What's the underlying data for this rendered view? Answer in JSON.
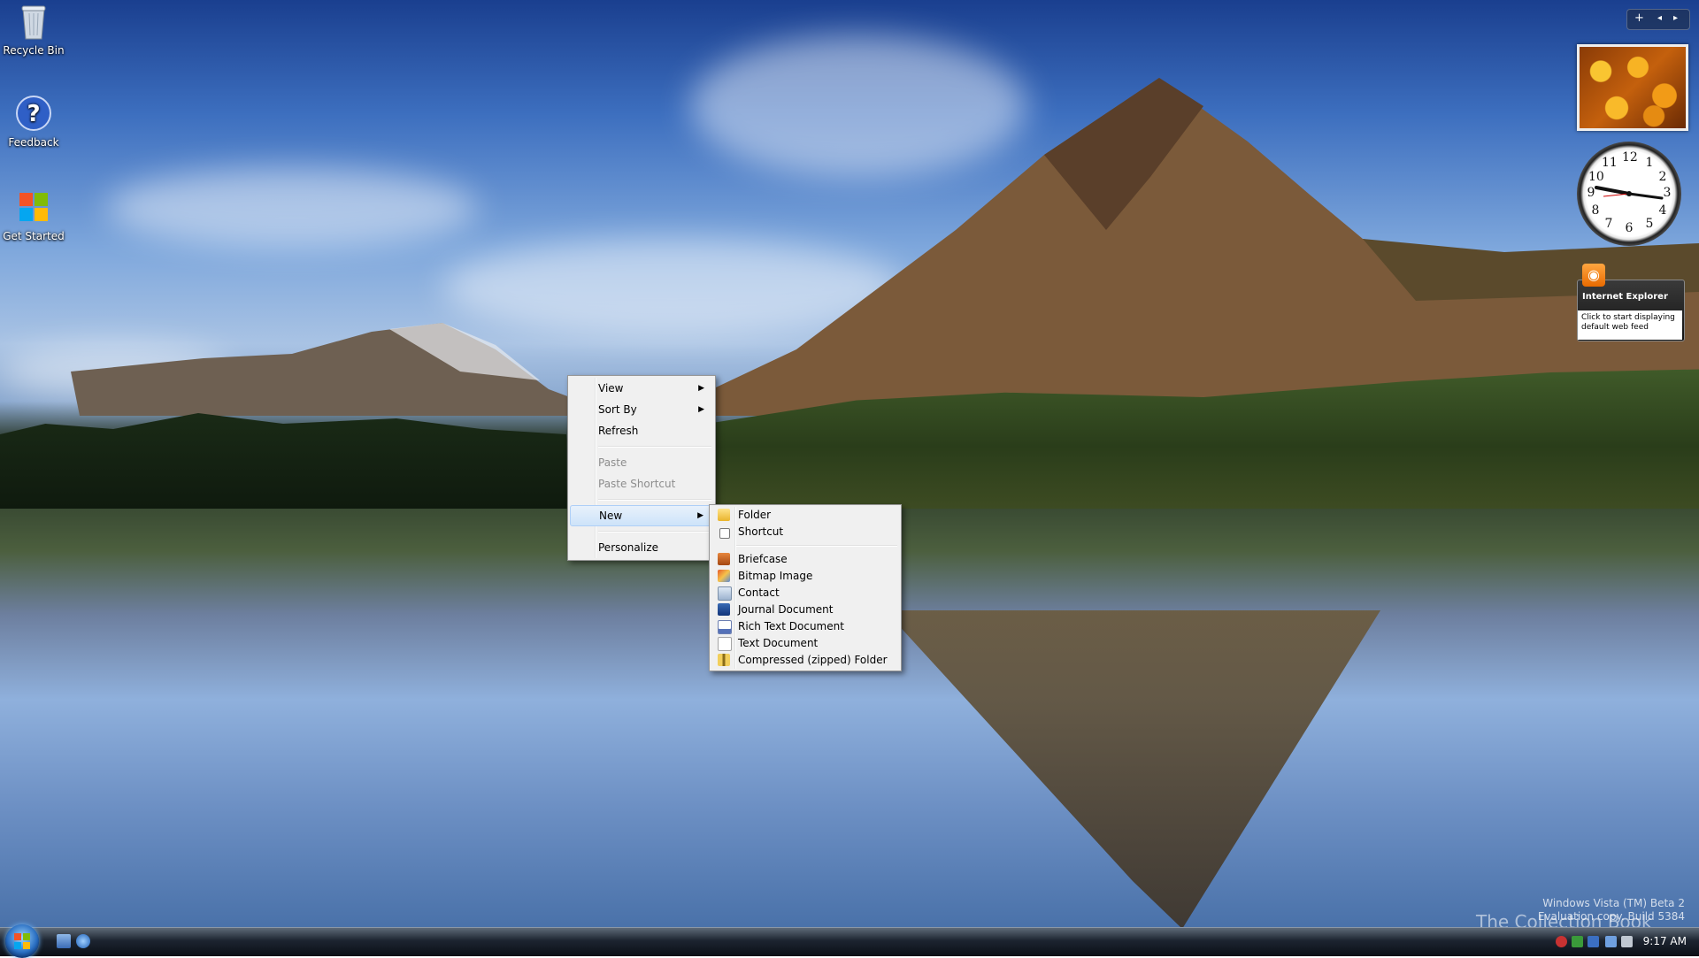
{
  "desktop_icons": [
    {
      "label": "Recycle Bin",
      "icon": "recycle-bin-icon"
    },
    {
      "label": "Feedback",
      "icon": "help-icon"
    },
    {
      "label": "Get Started",
      "icon": "windows-logo-icon"
    }
  ],
  "context_menu": {
    "items": [
      {
        "label": "View",
        "submenu": true
      },
      {
        "label": "Sort By",
        "submenu": true
      },
      {
        "label": "Refresh"
      },
      {
        "label": "Paste",
        "disabled": true
      },
      {
        "label": "Paste Shortcut",
        "disabled": true
      },
      {
        "label": "New",
        "submenu": true,
        "highlighted": true
      },
      {
        "label": "Personalize"
      }
    ]
  },
  "new_submenu": {
    "items": [
      {
        "label": "Folder",
        "icon": "folder-icon"
      },
      {
        "label": "Shortcut",
        "icon": "shortcut-icon"
      },
      {
        "label": "Briefcase",
        "icon": "briefcase-icon"
      },
      {
        "label": "Bitmap Image",
        "icon": "bitmap-image-icon"
      },
      {
        "label": "Contact",
        "icon": "contact-icon"
      },
      {
        "label": "Journal Document",
        "icon": "journal-document-icon"
      },
      {
        "label": "Rich Text Document",
        "icon": "rich-text-document-icon"
      },
      {
        "label": "Text Document",
        "icon": "text-document-icon"
      },
      {
        "label": "Compressed (zipped) Folder",
        "icon": "zipped-folder-icon"
      }
    ]
  },
  "sidebar": {
    "add_button": "+",
    "prev_button": "◂",
    "next_button": "▸",
    "clock_numbers": [
      "12",
      "1",
      "2",
      "3",
      "4",
      "5",
      "6",
      "7",
      "8",
      "9",
      "10",
      "11"
    ],
    "feed": {
      "rss": "◉",
      "title": "Internet Explorer",
      "body": "Click to start displaying default web feed"
    }
  },
  "watermark": {
    "line1": "Windows Vista (TM) Beta 2",
    "line2": "Evaluation copy. Build 5384",
    "book": "The Collection Book"
  },
  "taskbar": {
    "time": "9:17 AM"
  },
  "colors": {
    "menu_bg": "#f0f0f0",
    "menu_highlight": "#cde3f9",
    "disabled_text": "#8d8d8d"
  }
}
